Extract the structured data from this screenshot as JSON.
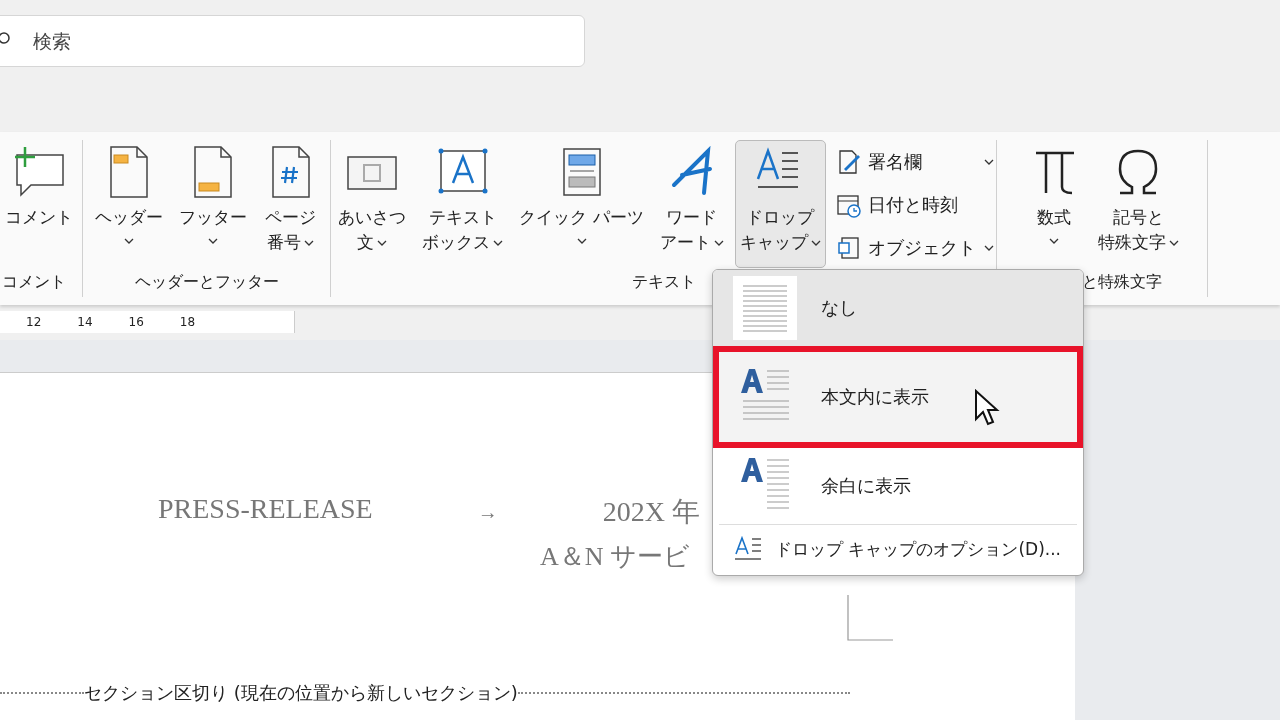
{
  "search": {
    "placeholder": "検索"
  },
  "ribbon": {
    "groups": [
      {
        "label": "コメント",
        "buttons": [
          {
            "kind": "comment",
            "lines": [
              "コメント"
            ],
            "dropdown": false,
            "pressed": false
          }
        ]
      },
      {
        "label": "ヘッダーとフッター",
        "buttons": [
          {
            "kind": "header",
            "lines": [
              "ヘッダー"
            ],
            "dropdown": true,
            "pressed": false
          },
          {
            "kind": "footer",
            "lines": [
              "フッター"
            ],
            "dropdown": true,
            "pressed": false
          },
          {
            "kind": "pagenum",
            "lines": [
              "ページ",
              "番号"
            ],
            "dropdown": true,
            "pressed": false
          }
        ]
      },
      {
        "label": "テキスト",
        "buttons": [
          {
            "kind": "greeting",
            "lines": [
              "あいさつ",
              "文"
            ],
            "dropdown": true,
            "pressed": false
          },
          {
            "kind": "textbox",
            "lines": [
              "テキスト",
              "ボックス"
            ],
            "dropdown": true,
            "pressed": false
          },
          {
            "kind": "quickparts",
            "lines": [
              "クイック パーツ"
            ],
            "dropdown": true,
            "pressed": false
          },
          {
            "kind": "wordart",
            "lines": [
              "ワード",
              "アート"
            ],
            "dropdown": true,
            "pressed": false
          },
          {
            "kind": "dropcap",
            "lines": [
              "ドロップ",
              "キャップ"
            ],
            "dropdown": true,
            "pressed": true
          }
        ],
        "small_buttons": [
          {
            "kind": "signature",
            "label": "署名欄",
            "dropdown": true
          },
          {
            "kind": "datetime",
            "label": "日付と時刻",
            "dropdown": false
          },
          {
            "kind": "object",
            "label": "オブジェクト",
            "dropdown": true
          }
        ]
      },
      {
        "label": "と特殊文字",
        "buttons": [
          {
            "kind": "equation",
            "lines": [
              "数式"
            ],
            "dropdown": true,
            "pressed": false
          },
          {
            "kind": "symbol",
            "lines": [
              "記号と",
              "特殊文字"
            ],
            "dropdown": true,
            "pressed": false
          }
        ]
      }
    ]
  },
  "ruler": {
    "numbers": [
      "12",
      "14",
      "16",
      "18"
    ]
  },
  "document": {
    "lines": [
      {
        "parts": [
          "PRESS-RELEASE",
          "→",
          "202X 年"
        ]
      },
      {
        "parts": [
          "A＆N サービ"
        ]
      }
    ],
    "section_break": "セクション区切り (現在の位置から新しいセクション)"
  },
  "dropcap_menu": {
    "items": [
      {
        "kind": "none",
        "label": "なし",
        "selected": true,
        "hovered": false,
        "highlighted": false
      },
      {
        "kind": "dropped",
        "label": "本文内に表示",
        "selected": false,
        "hovered": true,
        "highlighted": true
      },
      {
        "kind": "margin",
        "label": "余白に表示",
        "selected": false,
        "hovered": false,
        "highlighted": false
      }
    ],
    "options": "ドロップ キャップのオプション(D)..."
  }
}
